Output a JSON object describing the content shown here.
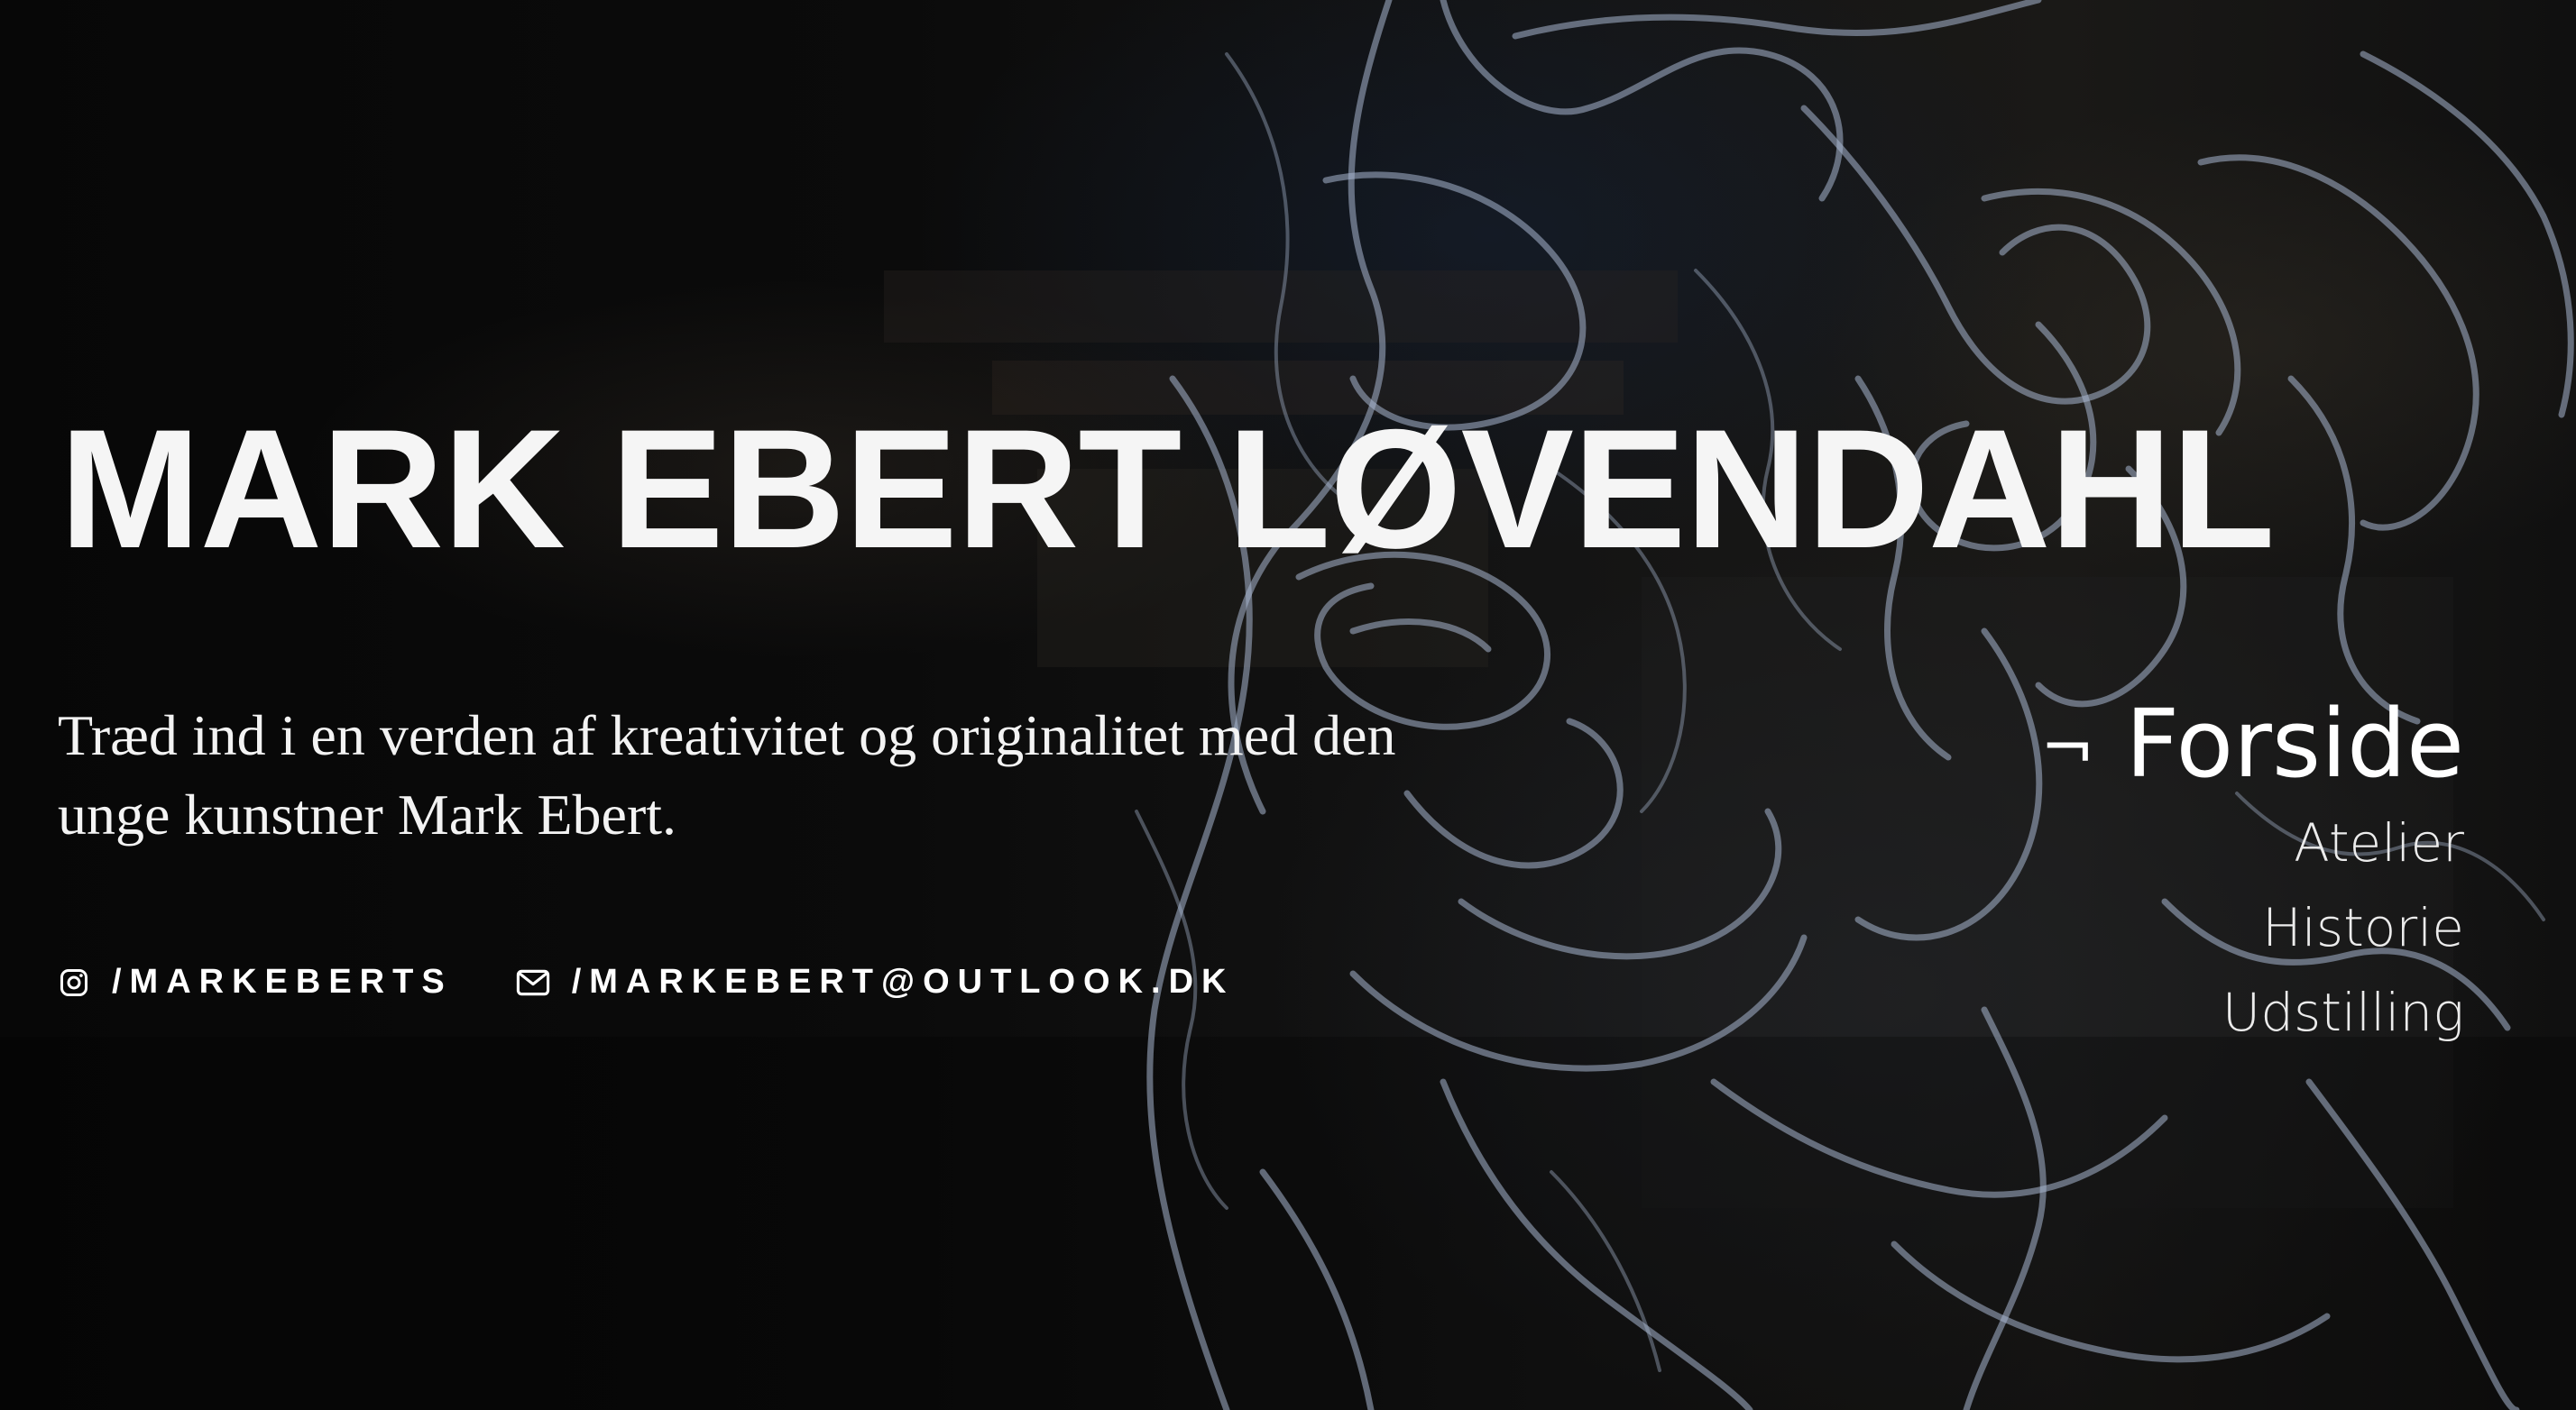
{
  "hero": {
    "title": "MARK EBERT LØVENDAHL",
    "tagline": "Træd ind i en verden af kreativitet og originalitet med den unge kunstner Mark Ebert."
  },
  "social": {
    "instagram": {
      "icon": "instagram-icon",
      "label": "/MARKEBERTS"
    },
    "email": {
      "icon": "mail-icon",
      "label": "/MARKEBERT@OUTLOOK.DK"
    }
  },
  "nav": {
    "active_marker": "¬",
    "items": [
      {
        "label": "Forside",
        "active": true
      },
      {
        "label": "Atelier",
        "active": false
      },
      {
        "label": "Historie",
        "active": false
      },
      {
        "label": "Udstilling",
        "active": false
      }
    ]
  },
  "colors": {
    "background": "#0a0a0a",
    "text": "#ffffff",
    "line_art": "#a7b7cf"
  }
}
